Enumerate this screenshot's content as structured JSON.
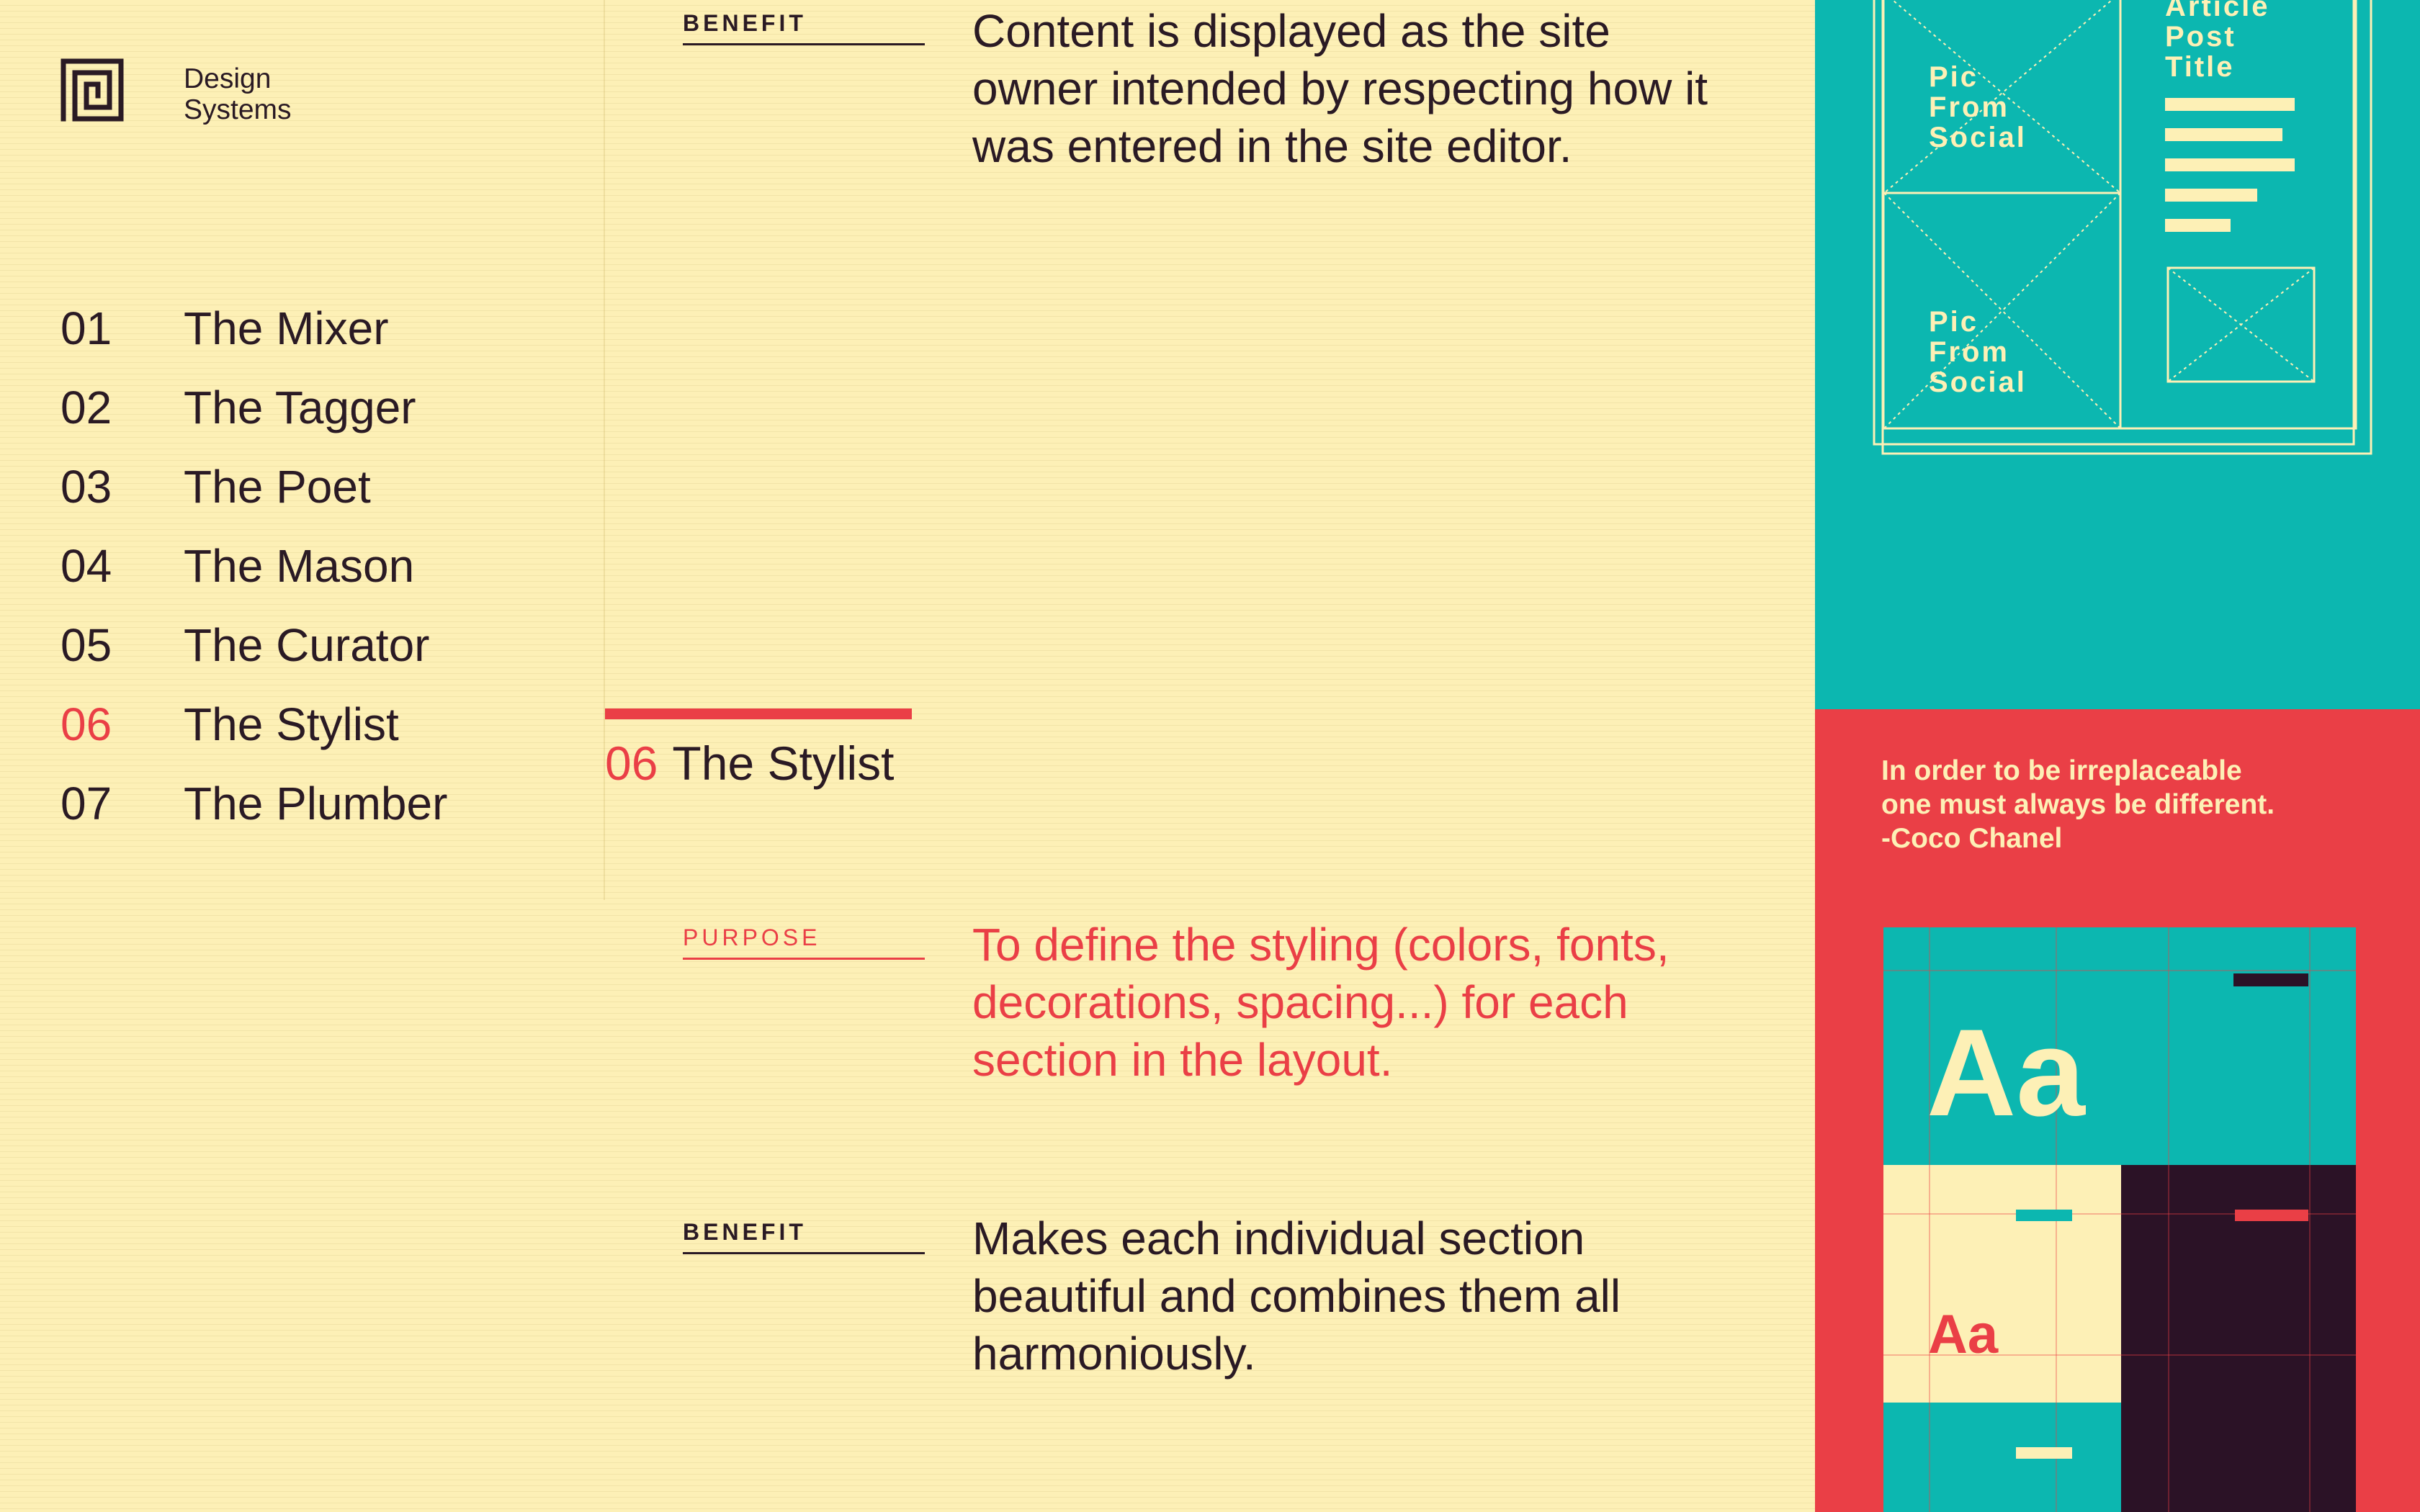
{
  "brand": {
    "line1": "Design",
    "line2": "Systems"
  },
  "nav": [
    {
      "num": "01",
      "label": "The Mixer"
    },
    {
      "num": "02",
      "label": "The Tagger"
    },
    {
      "num": "03",
      "label": "The Poet"
    },
    {
      "num": "04",
      "label": "The Mason"
    },
    {
      "num": "05",
      "label": "The Curator"
    },
    {
      "num": "06",
      "label": "The Stylist",
      "active": true
    },
    {
      "num": "07",
      "label": "The Plumber"
    }
  ],
  "top_block": {
    "label": "BENEFIT",
    "text": "Content is displayed as the site owner intended by respecting how it was entered in the site editor."
  },
  "section": {
    "num": "06",
    "title": "The Stylist"
  },
  "purpose": {
    "label": "PURPOSE",
    "text": "To define the styling (colors, fonts, decorations, spacing...) for each section in the layout."
  },
  "benefit": {
    "label": "BENEFIT",
    "text": "Makes each individual section beautiful and combines them all harmoniously."
  },
  "wireframe": {
    "pic_label_1": [
      "Pic",
      "From",
      "Social"
    ],
    "pic_label_2": [
      "Pic",
      "From",
      "Social"
    ],
    "article_label": [
      "Article",
      "Post",
      "Title"
    ]
  },
  "quote": {
    "line1": "In order to be irreplaceable",
    "line2": "one must always be different.",
    "line3": "-Coco Chanel"
  },
  "type_samples": {
    "large": "Aa",
    "small": "Aa"
  },
  "colors": {
    "background": "#fdf0b6",
    "ink": "#2a1a24",
    "accent_red": "#ea3f46",
    "teal": "#0cb7b0",
    "dark_plum": "#2b1226"
  }
}
